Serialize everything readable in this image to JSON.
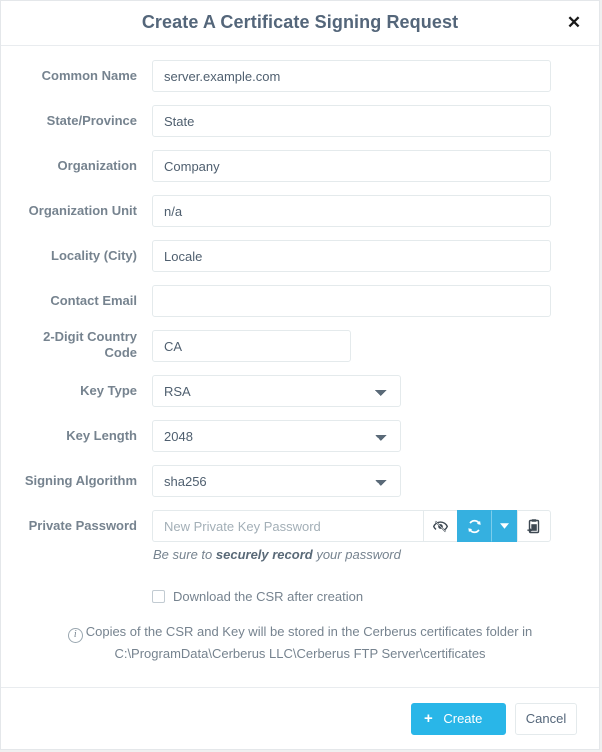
{
  "dialog": {
    "title": "Create A Certificate Signing Request",
    "close_icon": "close-icon",
    "close_label": "✕"
  },
  "form": {
    "fields": [
      {
        "label": "Common Name",
        "value": "server.example.com",
        "placeholder": "",
        "type": "text",
        "width": "wide"
      },
      {
        "label": "State/Province",
        "value": "State",
        "placeholder": "",
        "type": "text",
        "width": "wide"
      },
      {
        "label": "Organization",
        "value": "Company",
        "placeholder": "",
        "type": "text",
        "width": "wide"
      },
      {
        "label": "Organization Unit",
        "value": "n/a",
        "placeholder": "",
        "type": "text",
        "width": "wide"
      },
      {
        "label": "Locality (City)",
        "value": "Locale",
        "placeholder": "",
        "type": "text",
        "width": "wide"
      },
      {
        "label": "Contact Email",
        "value": "",
        "placeholder": "",
        "type": "text",
        "width": "wide"
      },
      {
        "label": "2-Digit Country Code",
        "label_line1": "2-Digit Country",
        "label_line2": "Code",
        "value": "CA",
        "placeholder": "",
        "type": "text",
        "width": "small"
      },
      {
        "label": "Key Type",
        "value": "RSA",
        "type": "select",
        "width": "mid"
      },
      {
        "label": "Key Length",
        "value": "2048",
        "type": "select",
        "width": "mid"
      },
      {
        "label": "Signing Algorithm",
        "value": "sha256",
        "type": "select",
        "width": "mid"
      }
    ],
    "password": {
      "label": "Private Password",
      "value": "",
      "placeholder": "New Private Key Password",
      "buttons": [
        {
          "name": "toggle-password-visibility-button",
          "icon": "eye-slash-icon",
          "style": "white"
        },
        {
          "name": "generate-password-button",
          "icon": "refresh-icon",
          "style": "blue"
        },
        {
          "name": "generate-password-options-button",
          "icon": "caret-down-icon",
          "style": "blue-caret"
        },
        {
          "name": "copy-password-button",
          "icon": "clipboard-paste-icon",
          "style": "white"
        }
      ],
      "hint_before": "Be sure to ",
      "hint_bold": "securely record",
      "hint_after": " your password"
    },
    "download_checkbox": {
      "label": "Download the CSR after creation",
      "checked": false
    },
    "note": {
      "icon": "info-circle-icon",
      "icon_glyph": "i",
      "line1": "Copies of the CSR and Key will be stored in the Cerberus certificates folder in",
      "line2": "C:\\ProgramData\\Cerberus LLC\\Cerberus FTP Server\\certificates"
    }
  },
  "footer": {
    "create_label": "Create",
    "create_icon": "plus-icon",
    "create_icon_glyph": "+",
    "cancel_label": "Cancel"
  },
  "colors": {
    "accent_blue": "#29b6e8",
    "input_group_blue": "#35b0e0",
    "label_gray": "#76838f",
    "title_gray": "#54667a",
    "border_gray": "#e4eaec"
  }
}
